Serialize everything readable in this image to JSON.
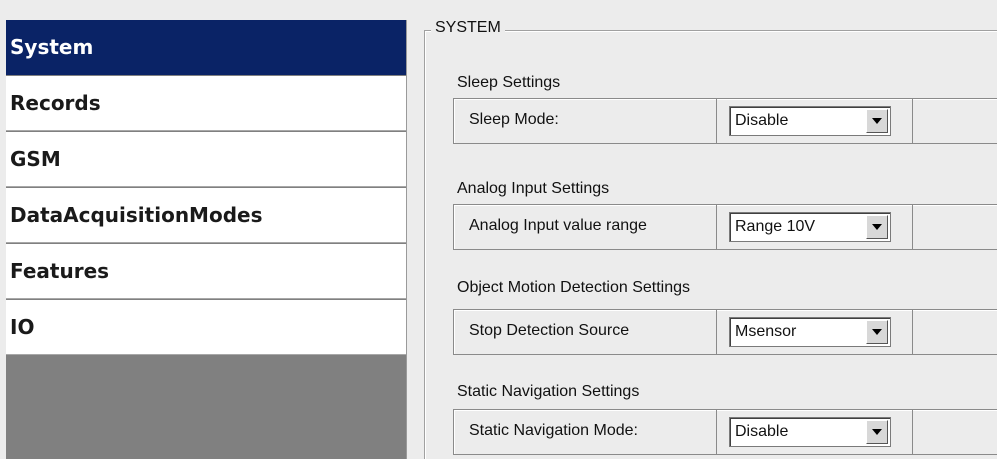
{
  "sidebar": {
    "items": [
      {
        "label": "System",
        "active": true
      },
      {
        "label": "Records",
        "active": false
      },
      {
        "label": "GSM",
        "active": false
      },
      {
        "label": "DataAcquisitionModes",
        "active": false
      },
      {
        "label": "Features",
        "active": false
      },
      {
        "label": "IO",
        "active": false
      }
    ]
  },
  "main": {
    "group_title": "SYSTEM",
    "sections": [
      {
        "title": "Sleep Settings",
        "setting_label": "Sleep Mode:",
        "value": "Disable"
      },
      {
        "title": "Analog Input Settings",
        "setting_label": "Analog Input value range",
        "value": "Range 10V"
      },
      {
        "title": "Object Motion Detection Settings",
        "setting_label": "Stop Detection Source",
        "value": "Msensor"
      },
      {
        "title": "Static Navigation Settings",
        "setting_label": "Static Navigation Mode:",
        "value": "Disable"
      }
    ]
  },
  "colors": {
    "active_nav_bg": "#0a2366",
    "sidebar_fill": "#808080",
    "panel_bg": "#ececec"
  }
}
